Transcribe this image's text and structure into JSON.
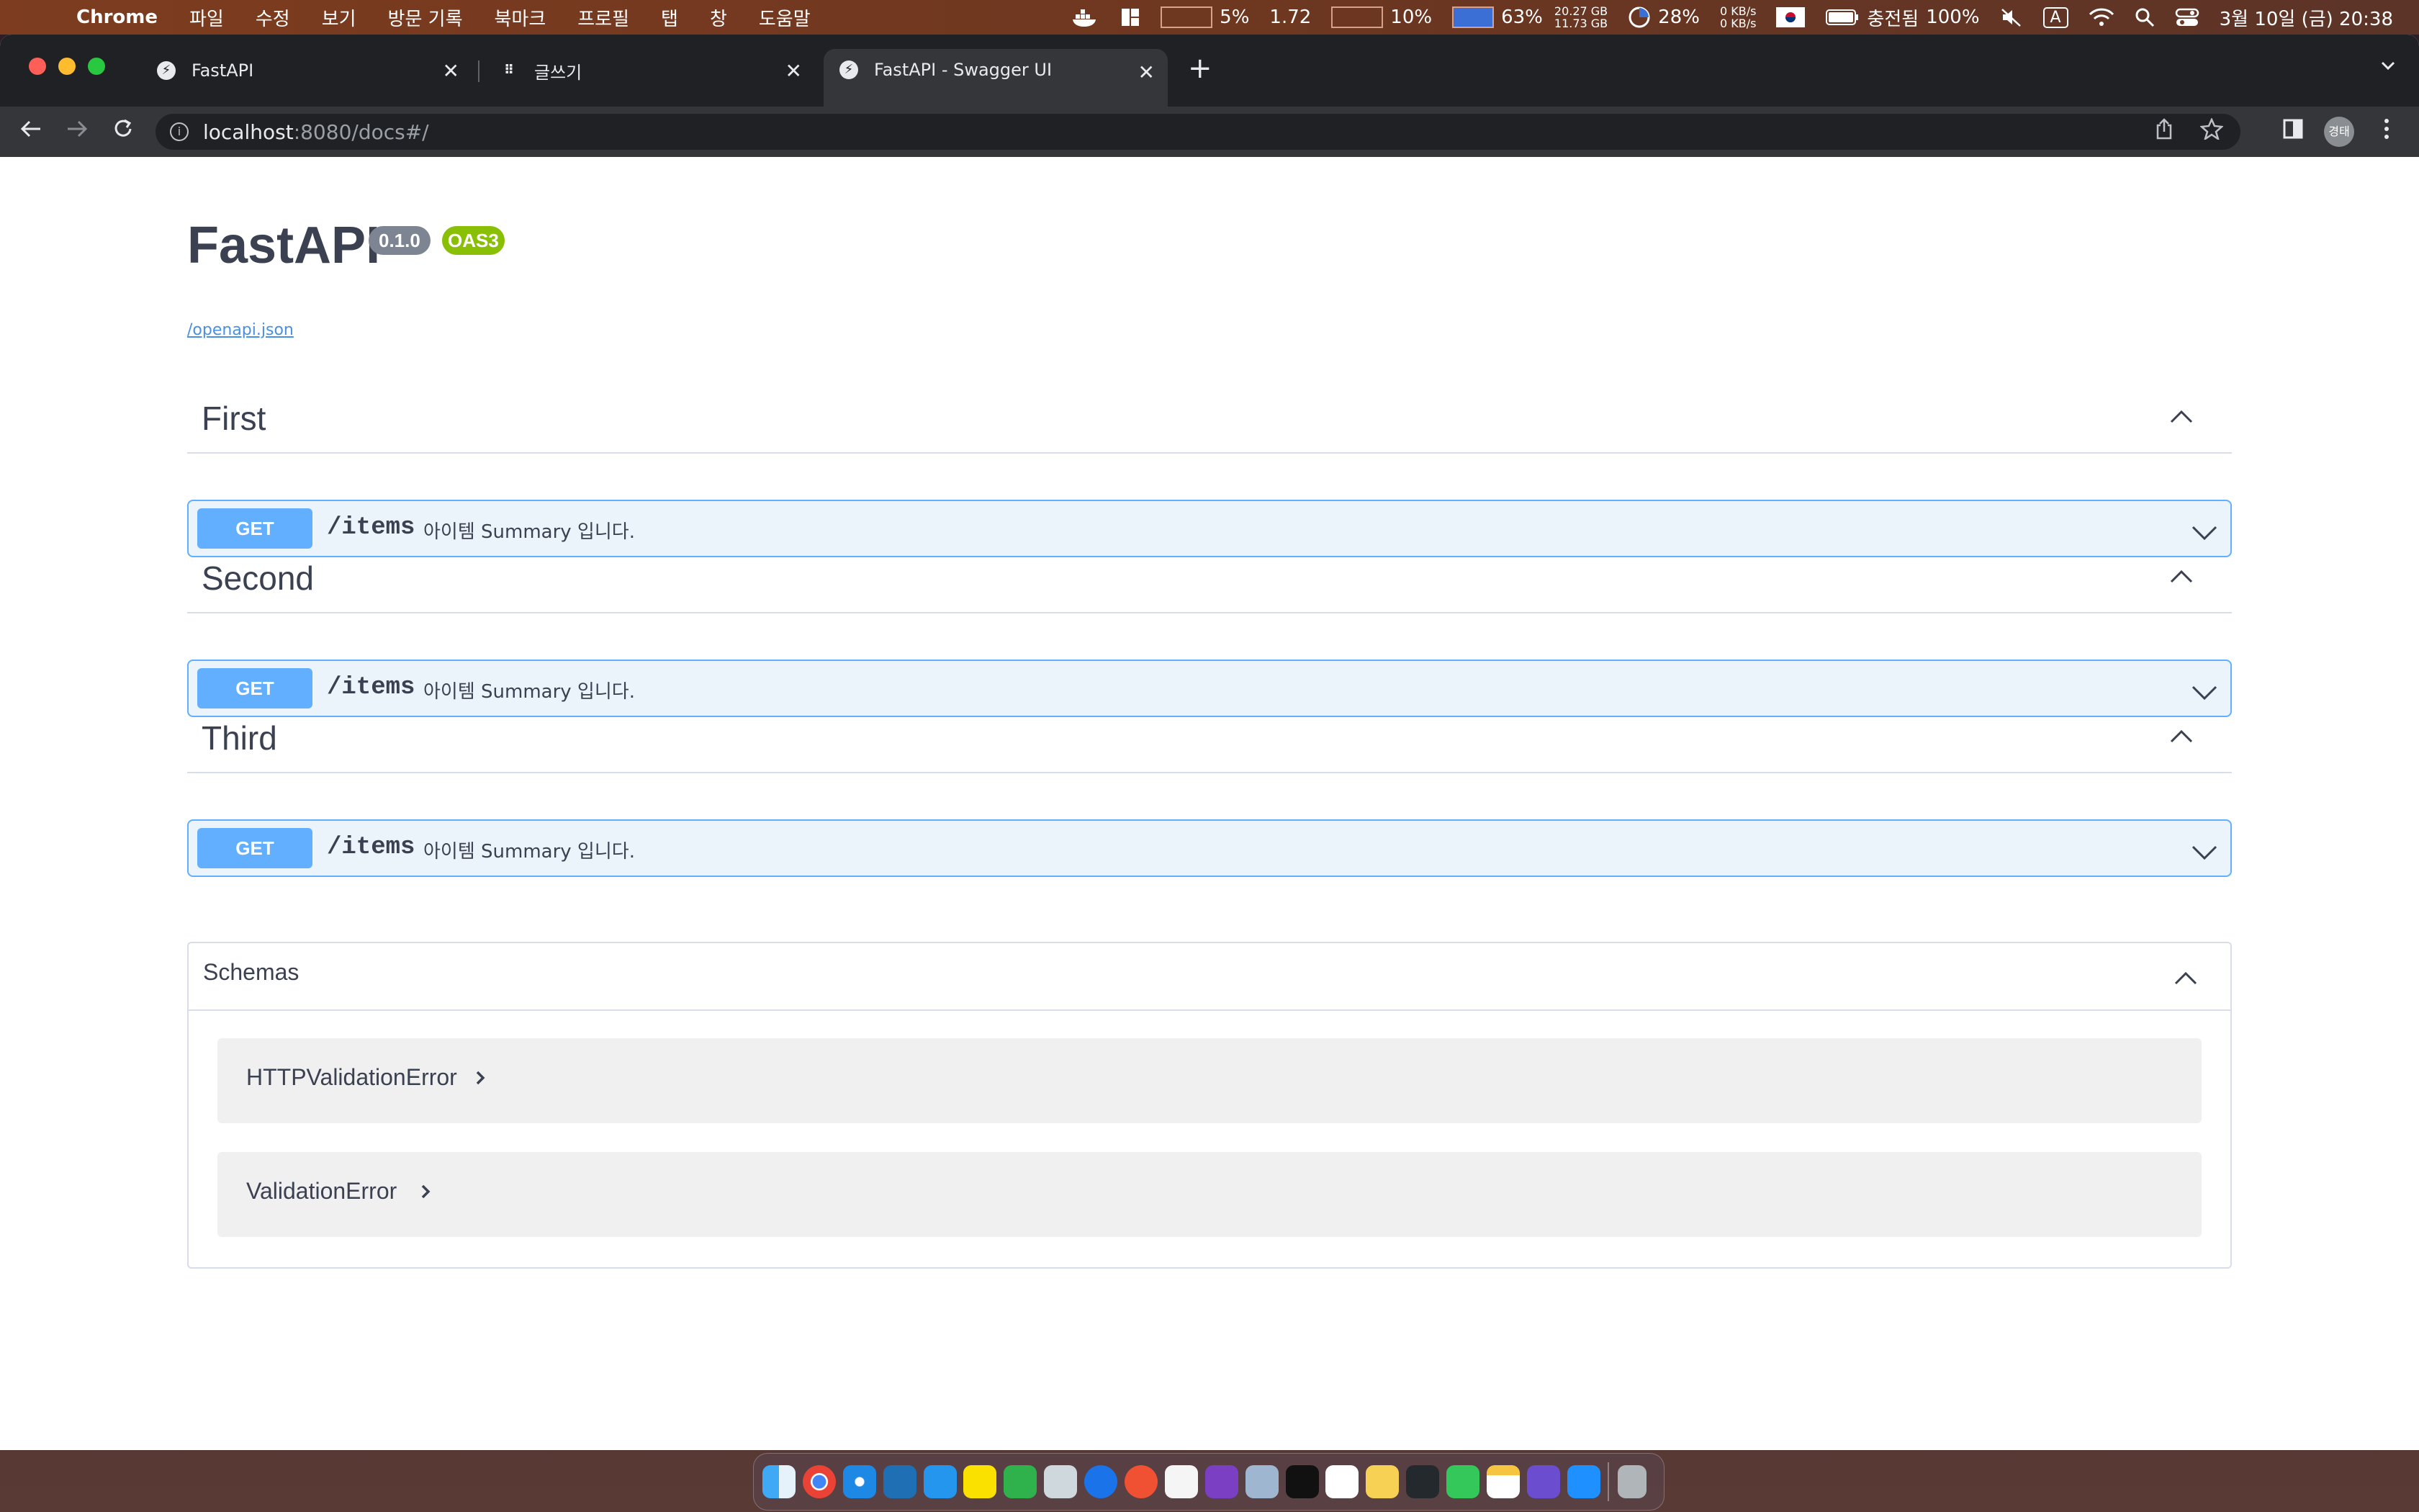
{
  "menubar": {
    "app_name": "Chrome",
    "menus": [
      "파일",
      "수정",
      "보기",
      "방문 기록",
      "북마크",
      "프로필",
      "탭",
      "창",
      "도움말"
    ],
    "cpu_percent": "5%",
    "load": "1.72",
    "gpu_percent": "10%",
    "mem_percent": "63%",
    "mem_used": "20.27 GB",
    "mem_free": "11.73 GB",
    "disk_percent": "28%",
    "net_up": "0 KB/s",
    "net_down": "0 KB/s",
    "battery_status": "충전됨",
    "battery_percent": "100%",
    "input_source": "A",
    "clock": "3월 10일 (금) 20:38"
  },
  "browser": {
    "tabs": [
      {
        "title": "FastAPI",
        "active": false
      },
      {
        "title": "글쓰기",
        "active": false
      },
      {
        "title": "FastAPI - Swagger UI",
        "active": true
      }
    ],
    "url_host": "localhost",
    "url_path": ":8080/docs#/",
    "profile_initials": "경태"
  },
  "swagger": {
    "title": "FastAPI",
    "version": "0.1.0",
    "oas": "OAS3",
    "spec_link": "/openapi.json",
    "colors": {
      "get": "#61affe",
      "get_bg": "#ebf3fb",
      "version_badge": "#7d8492",
      "oas_badge": "#89bf04"
    },
    "tags": [
      {
        "name": "First",
        "operations": [
          {
            "method": "GET",
            "path": "/items",
            "summary": "아이템 Summary 입니다."
          }
        ]
      },
      {
        "name": "Second",
        "operations": [
          {
            "method": "GET",
            "path": "/items",
            "summary": "아이템 Summary 입니다."
          }
        ]
      },
      {
        "name": "Third",
        "operations": [
          {
            "method": "GET",
            "path": "/items",
            "summary": "아이템 Summary 입니다."
          }
        ]
      }
    ],
    "schemas_label": "Schemas",
    "schemas": [
      "HTTPValidationError",
      "ValidationError"
    ]
  },
  "dock": {
    "icons": [
      "finder-icon",
      "chrome-icon",
      "safari-icon",
      "vscode-icon",
      "docker-icon",
      "kakaotalk-icon",
      "messages-icon",
      "preview-icon",
      "maps-icon",
      "dev-tool-icon",
      "notes-app-icon",
      "visual-studio-icon",
      "virtualbox-icon",
      "terminal-icon",
      "slack-icon",
      "stickies-icon",
      "github-icon",
      "facetime-icon",
      "notes-icon",
      "tableplus-icon",
      "app-store-icon",
      "trash-icon"
    ]
  }
}
